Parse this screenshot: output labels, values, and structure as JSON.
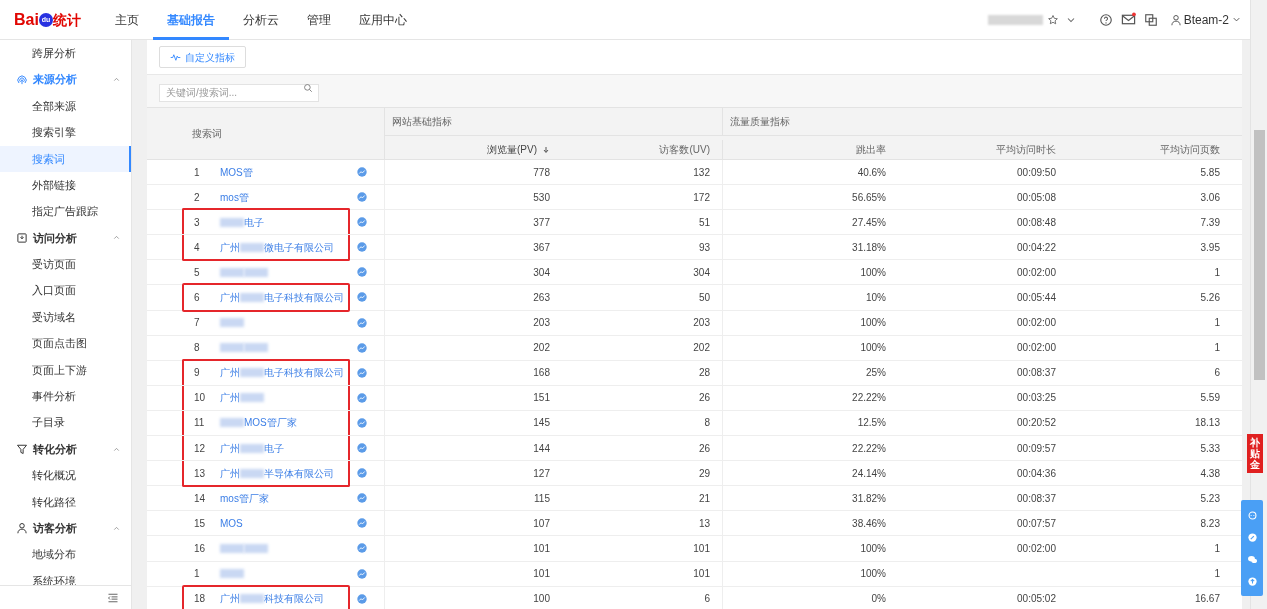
{
  "header": {
    "logo": {
      "brand": "Bai",
      "badge": "du",
      "product": "统计"
    },
    "nav": [
      {
        "label": "主页",
        "selected": false
      },
      {
        "label": "基础报告",
        "selected": true
      },
      {
        "label": "分析云",
        "selected": false
      },
      {
        "label": "管理",
        "selected": false
      },
      {
        "label": "应用中心",
        "selected": false
      }
    ],
    "mail_unread": true,
    "user": "Bteam-2"
  },
  "sidebar": {
    "items": [
      {
        "kind": "item",
        "label": "跨屏分析",
        "selected": false
      },
      {
        "kind": "group",
        "label": "来源分析",
        "expanded": true,
        "children": [
          {
            "label": "全部来源",
            "selected": false
          },
          {
            "label": "搜索引擎",
            "selected": false
          },
          {
            "label": "搜索词",
            "selected": true
          },
          {
            "label": "外部链接",
            "selected": false
          },
          {
            "label": "指定广告跟踪",
            "selected": false
          }
        ]
      },
      {
        "kind": "group",
        "label": "访问分析",
        "expanded": true,
        "children": [
          {
            "label": "受访页面",
            "selected": false
          },
          {
            "label": "入口页面",
            "selected": false
          },
          {
            "label": "受访域名",
            "selected": false
          },
          {
            "label": "页面点击图",
            "selected": false
          },
          {
            "label": "页面上下游",
            "selected": false
          },
          {
            "label": "事件分析",
            "selected": false
          },
          {
            "label": "子目录",
            "selected": false
          }
        ]
      },
      {
        "kind": "group",
        "label": "转化分析",
        "expanded": true,
        "children": [
          {
            "label": "转化概况",
            "selected": false
          },
          {
            "label": "转化路径",
            "selected": false
          }
        ]
      },
      {
        "kind": "group",
        "label": "访客分析",
        "expanded": true,
        "children": [
          {
            "label": "地域分布",
            "selected": false
          },
          {
            "label": "系统环境",
            "selected": false
          }
        ]
      }
    ]
  },
  "toolbar": {
    "custom_metrics_button": "自定义指标",
    "search": {
      "placeholder": "关键词/搜索词..."
    }
  },
  "table": {
    "keyword_header": "搜索词",
    "groups": [
      {
        "label": "网站基础指标",
        "columns": [
          {
            "label": "浏览量(PV)",
            "sorted": true
          },
          {
            "label": "访客数(UV)",
            "sorted": false
          }
        ]
      },
      {
        "label": "流量质量指标",
        "columns": [
          {
            "label": "跳出率",
            "sorted": false
          },
          {
            "label": "平均访问时长",
            "sorted": false
          },
          {
            "label": "平均访问页数",
            "sorted": false
          }
        ]
      }
    ],
    "rows": [
      {
        "rank": "1",
        "keyword": [
          {
            "kind": "text",
            "text": "MOS管"
          }
        ],
        "boxed": false,
        "pv": "778",
        "uv": "132",
        "bounce_rate": "40.6%",
        "avg_duration": "00:09:50",
        "avg_pages": "5.85"
      },
      {
        "rank": "2",
        "keyword": [
          {
            "kind": "text",
            "text": "mos管"
          }
        ],
        "boxed": false,
        "pv": "530",
        "uv": "172",
        "bounce_rate": "56.65%",
        "avg_duration": "00:05:08",
        "avg_pages": "3.06"
      },
      {
        "rank": "3",
        "keyword": [
          {
            "kind": "blur"
          },
          {
            "kind": "text",
            "text": "电子"
          }
        ],
        "boxed": true,
        "pv": "377",
        "uv": "51",
        "bounce_rate": "27.45%",
        "avg_duration": "00:08:48",
        "avg_pages": "7.39"
      },
      {
        "rank": "4",
        "keyword": [
          {
            "kind": "text",
            "text": "广州"
          },
          {
            "kind": "blur"
          },
          {
            "kind": "text",
            "text": "微电子有限公司"
          }
        ],
        "boxed": true,
        "pv": "367",
        "uv": "93",
        "bounce_rate": "31.18%",
        "avg_duration": "00:04:22",
        "avg_pages": "3.95"
      },
      {
        "rank": "5",
        "keyword": [
          {
            "kind": "blur"
          },
          {
            "kind": "blur"
          }
        ],
        "boxed": false,
        "pv": "304",
        "uv": "304",
        "bounce_rate": "100%",
        "avg_duration": "00:02:00",
        "avg_pages": "1"
      },
      {
        "rank": "6",
        "keyword": [
          {
            "kind": "text",
            "text": "广州"
          },
          {
            "kind": "blur"
          },
          {
            "kind": "text",
            "text": "电子科技有限公司"
          }
        ],
        "boxed": true,
        "pv": "263",
        "uv": "50",
        "bounce_rate": "10%",
        "avg_duration": "00:05:44",
        "avg_pages": "5.26"
      },
      {
        "rank": "7",
        "keyword": [
          {
            "kind": "blur"
          }
        ],
        "boxed": false,
        "pv": "203",
        "uv": "203",
        "bounce_rate": "100%",
        "avg_duration": "00:02:00",
        "avg_pages": "1"
      },
      {
        "rank": "8",
        "keyword": [
          {
            "kind": "blur"
          },
          {
            "kind": "blur"
          }
        ],
        "boxed": false,
        "pv": "202",
        "uv": "202",
        "bounce_rate": "100%",
        "avg_duration": "00:02:00",
        "avg_pages": "1"
      },
      {
        "rank": "9",
        "keyword": [
          {
            "kind": "text",
            "text": "广州"
          },
          {
            "kind": "blur"
          },
          {
            "kind": "text",
            "text": "电子科技有限公司"
          }
        ],
        "boxed": true,
        "pv": "168",
        "uv": "28",
        "bounce_rate": "25%",
        "avg_duration": "00:08:37",
        "avg_pages": "6"
      },
      {
        "rank": "10",
        "keyword": [
          {
            "kind": "text",
            "text": "广州"
          },
          {
            "kind": "blur"
          }
        ],
        "boxed": true,
        "pv": "151",
        "uv": "26",
        "bounce_rate": "22.22%",
        "avg_duration": "00:03:25",
        "avg_pages": "5.59"
      },
      {
        "rank": "11",
        "keyword": [
          {
            "kind": "blur"
          },
          {
            "kind": "text",
            "text": "MOS管厂家"
          }
        ],
        "boxed": true,
        "pv": "145",
        "uv": "8",
        "bounce_rate": "12.5%",
        "avg_duration": "00:20:52",
        "avg_pages": "18.13"
      },
      {
        "rank": "12",
        "keyword": [
          {
            "kind": "text",
            "text": "广州"
          },
          {
            "kind": "blur"
          },
          {
            "kind": "text",
            "text": "电子"
          }
        ],
        "boxed": true,
        "pv": "144",
        "uv": "26",
        "bounce_rate": "22.22%",
        "avg_duration": "00:09:57",
        "avg_pages": "5.33"
      },
      {
        "rank": "13",
        "keyword": [
          {
            "kind": "text",
            "text": "广州"
          },
          {
            "kind": "blur"
          },
          {
            "kind": "text",
            "text": "半导体有限公司"
          }
        ],
        "boxed": true,
        "pv": "127",
        "uv": "29",
        "bounce_rate": "24.14%",
        "avg_duration": "00:04:36",
        "avg_pages": "4.38"
      },
      {
        "rank": "14",
        "keyword": [
          {
            "kind": "text",
            "text": "mos管厂家"
          }
        ],
        "boxed": false,
        "pv": "115",
        "uv": "21",
        "bounce_rate": "31.82%",
        "avg_duration": "00:08:37",
        "avg_pages": "5.23"
      },
      {
        "rank": "15",
        "keyword": [
          {
            "kind": "text",
            "text": "MOS"
          }
        ],
        "boxed": false,
        "pv": "107",
        "uv": "13",
        "bounce_rate": "38.46%",
        "avg_duration": "00:07:57",
        "avg_pages": "8.23"
      },
      {
        "rank": "16",
        "keyword": [
          {
            "kind": "blur"
          },
          {
            "kind": "blur"
          }
        ],
        "boxed": false,
        "pv": "101",
        "uv": "101",
        "bounce_rate": "100%",
        "avg_duration": "00:02:00",
        "avg_pages": "1"
      },
      {
        "rank": "1",
        "keyword": [
          {
            "kind": "blur"
          }
        ],
        "boxed": false,
        "pv": "101",
        "uv": "101",
        "bounce_rate": "100%",
        "avg_pages": "1"
      },
      {
        "rank": "18",
        "keyword": [
          {
            "kind": "text",
            "text": "广州"
          },
          {
            "kind": "blur"
          },
          {
            "kind": "text",
            "text": "科技有限公司"
          }
        ],
        "boxed": true,
        "pv": "100",
        "uv": "6",
        "bounce_rate": "0%",
        "avg_duration": "00:05:02",
        "avg_pages": "16.67"
      }
    ]
  },
  "promo_tab": "补贴金"
}
